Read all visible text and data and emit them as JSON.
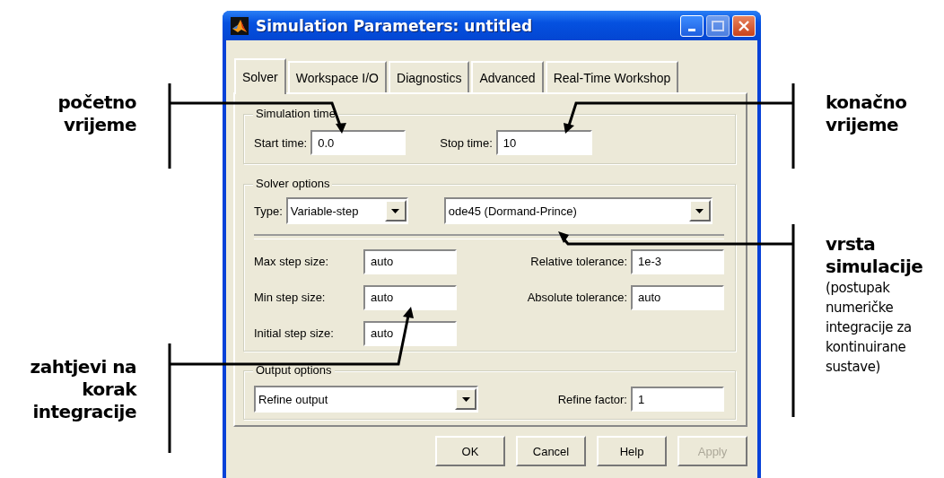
{
  "window": {
    "title": "Simulation Parameters: untitled"
  },
  "tabs": [
    {
      "label": "Solver",
      "selected": true
    },
    {
      "label": "Workspace I/O",
      "selected": false
    },
    {
      "label": "Diagnostics",
      "selected": false
    },
    {
      "label": "Advanced",
      "selected": false
    },
    {
      "label": "Real-Time Workshop",
      "selected": false
    }
  ],
  "simulation_time": {
    "title": "Simulation time",
    "start_label": "Start time:",
    "start_value": "0.0",
    "stop_label": "Stop time:",
    "stop_value": "10"
  },
  "solver_options": {
    "title": "Solver options",
    "type_label": "Type:",
    "type_value": "Variable-step",
    "solver_value": "ode45 (Dormand-Prince)",
    "left_fields": [
      {
        "label": "Max step size:",
        "value": "auto"
      },
      {
        "label": "Min step size:",
        "value": "auto"
      },
      {
        "label": "Initial step size:",
        "value": "auto"
      }
    ],
    "right_fields": [
      {
        "label": "Relative tolerance:",
        "value": "1e-3"
      },
      {
        "label": "Absolute tolerance:",
        "value": "auto"
      }
    ]
  },
  "output_options": {
    "title": "Output options",
    "mode_value": "Refine output",
    "factor_label": "Refine factor:",
    "factor_value": "1"
  },
  "buttons": [
    {
      "label": "OK",
      "disabled": false
    },
    {
      "label": "Cancel",
      "disabled": false
    },
    {
      "label": "Help",
      "disabled": false
    },
    {
      "label": "Apply",
      "disabled": true
    }
  ],
  "annotations": {
    "left": [
      {
        "title": "početno vrijeme"
      },
      {
        "title": "zahtjevi na korak integracije"
      }
    ],
    "right": [
      {
        "title": "konačno vrijeme"
      },
      {
        "title": "vrsta simulacije",
        "note": "(postupak numeričke integracije za kontinuirane sustave)"
      }
    ]
  }
}
